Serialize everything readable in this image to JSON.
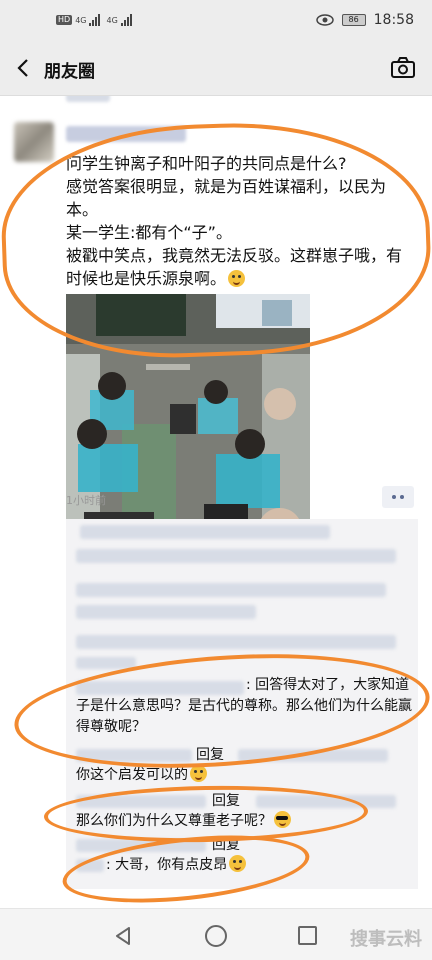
{
  "status_bar": {
    "hd_badge": "HD",
    "network_1": "4G",
    "network_2": "4G",
    "battery": "86",
    "time": "18:58"
  },
  "header": {
    "title": "朋友圈"
  },
  "post": {
    "text_lines": [
      "问学生钟离子和叶阳子的共同点是什么?",
      "感觉答案很明显，就是为百姓谋福利，以民为本。",
      "某一学生:都有个“子”。",
      "被戳中笑点，我竟然无法反驳。这群崽子哦，有时候也是快乐源泉啊。"
    ],
    "time": "1小时前"
  },
  "comments": [
    {
      "text": ": 回答得太对了，大家知道子是什么意思吗？是古代的尊称。那么他们为什么能赢得尊敬呢？"
    },
    {
      "reply_word": "回复",
      "text": "你这个启发可以的"
    },
    {
      "reply_word": "回复",
      "text": "那么你们为什么又尊重老子呢？"
    },
    {
      "reply_word": "回复",
      "text": ": 大哥，你有点皮昂"
    }
  ],
  "nav": {
    "watermark": "搜事云料"
  },
  "colors": {
    "annotation": "#f28a30",
    "header_bg": "#ededed",
    "link_blue": "#5b6a91"
  },
  "icons": [
    "back-arrow-icon",
    "camera-icon",
    "eye-icon",
    "emoji-icon",
    "nav-back-icon",
    "nav-home-icon",
    "nav-recent-icon"
  ]
}
